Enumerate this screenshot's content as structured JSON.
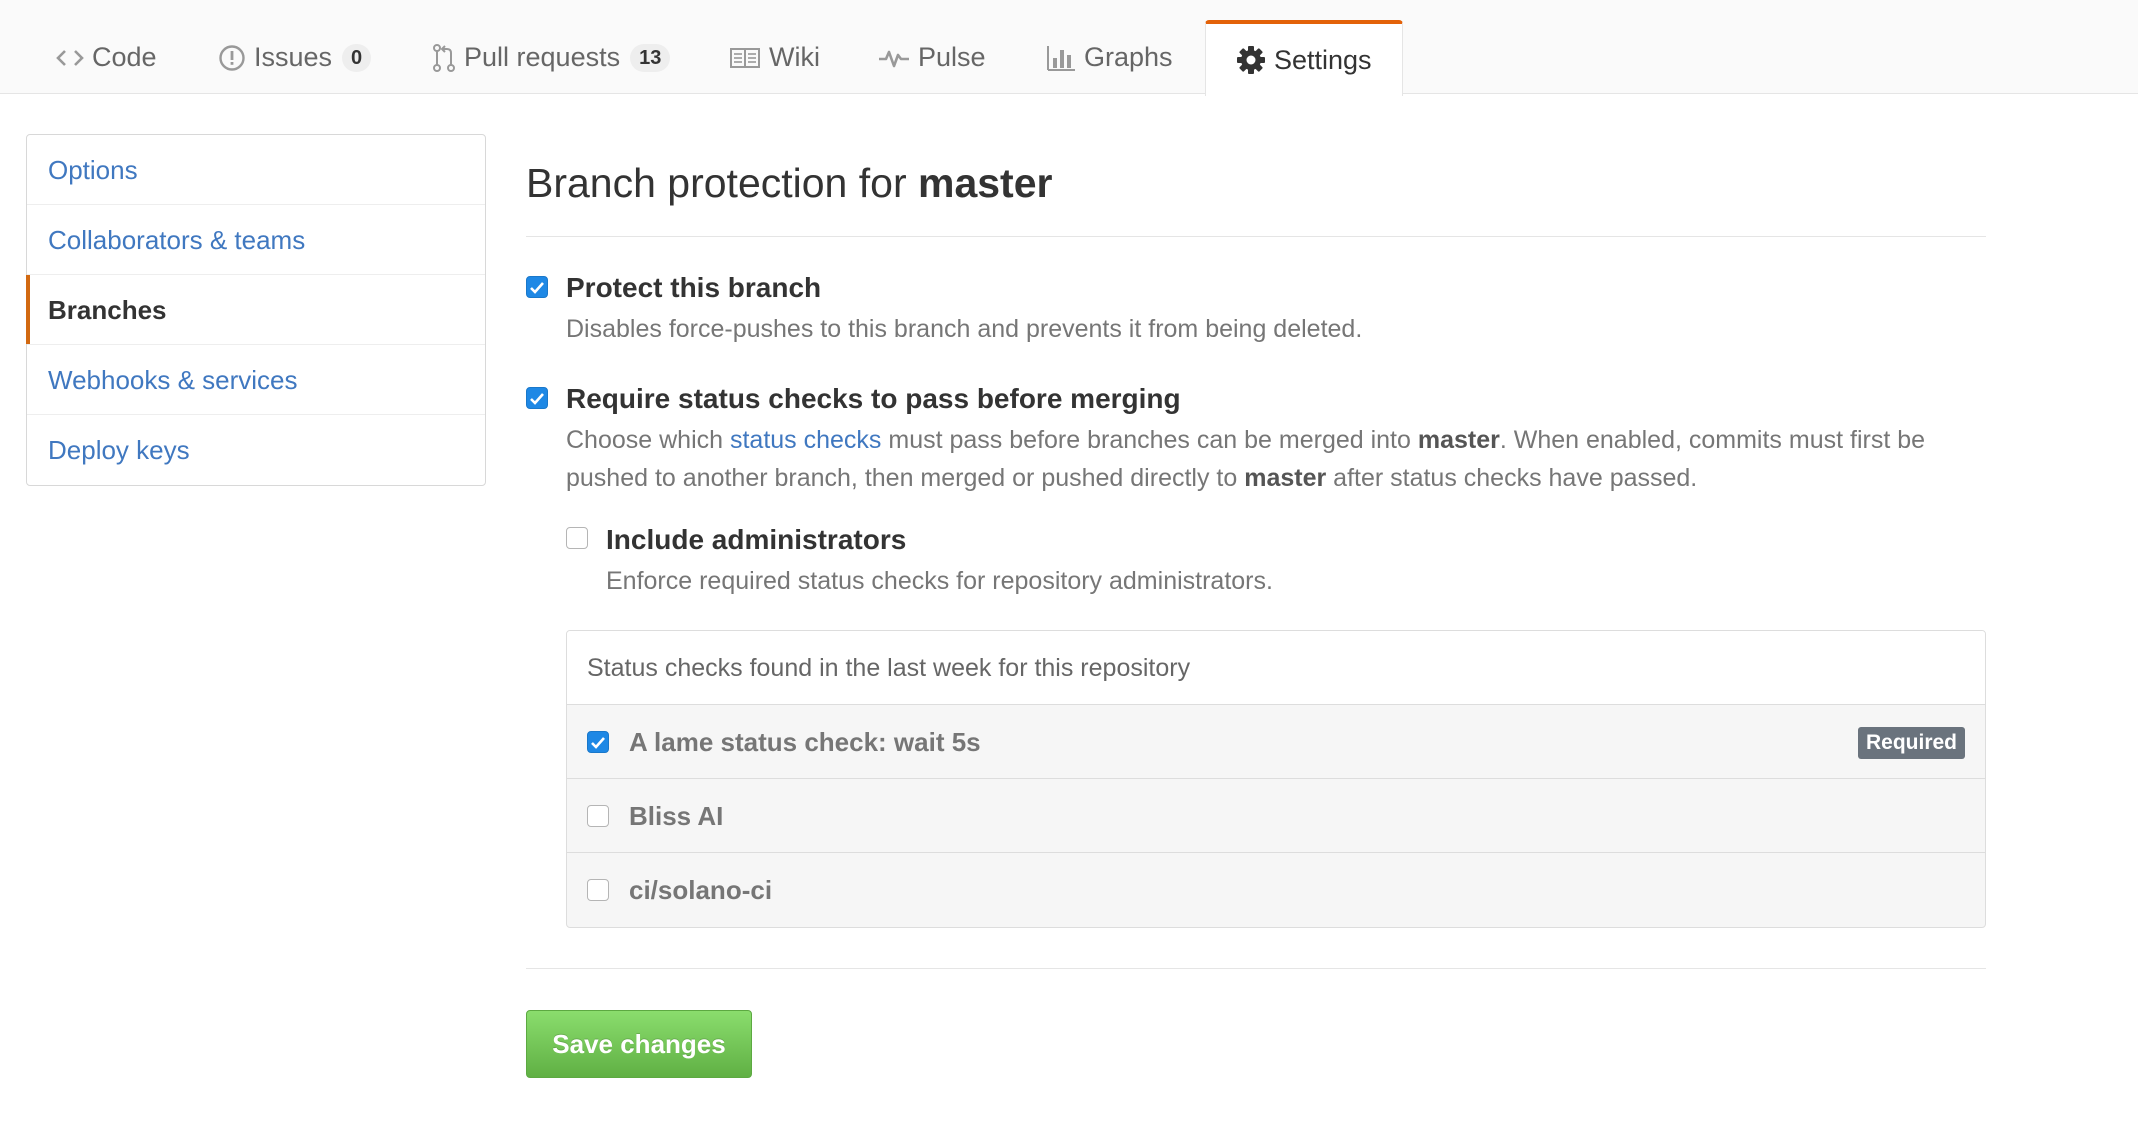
{
  "tabs": [
    {
      "label": "Code",
      "icon": "code-icon"
    },
    {
      "label": "Issues",
      "icon": "issue-opened-icon",
      "count": "0"
    },
    {
      "label": "Pull requests",
      "icon": "git-pull-request-icon",
      "count": "13"
    },
    {
      "label": "Wiki",
      "icon": "book-icon"
    },
    {
      "label": "Pulse",
      "icon": "pulse-icon"
    },
    {
      "label": "Graphs",
      "icon": "graph-icon"
    },
    {
      "label": "Settings",
      "icon": "gear-icon",
      "selected": true
    }
  ],
  "sidebar": {
    "items": [
      {
        "label": "Options"
      },
      {
        "label": "Collaborators & teams"
      },
      {
        "label": "Branches",
        "selected": true
      },
      {
        "label": "Webhooks & services"
      },
      {
        "label": "Deploy keys"
      }
    ]
  },
  "main": {
    "heading_prefix": "Branch protection for ",
    "heading_branch": "master",
    "protect": {
      "checked": true,
      "title": "Protect this branch",
      "note": "Disables force-pushes to this branch and prevents it from being deleted."
    },
    "status_checks": {
      "checked": true,
      "title": "Require status checks to pass before merging",
      "note_1": "Choose which ",
      "note_link": "status checks",
      "note_2": " must pass before branches can be merged into ",
      "note_branch_1": "master",
      "note_3": ". When enabled, commits must first be pushed to another branch, then merged or pushed directly to ",
      "note_branch_2": "master",
      "note_4": " after status checks have passed."
    },
    "admins": {
      "checked": false,
      "title": "Include administrators",
      "note": "Enforce required status checks for repository administrators."
    },
    "checks_box": {
      "header": "Status checks found in the last week for this repository",
      "rows": [
        {
          "name": "A lame status check: wait 5s",
          "checked": true,
          "badge": "Required"
        },
        {
          "name": "Bliss AI",
          "checked": false
        },
        {
          "name": "ci/solano-ci",
          "checked": false
        }
      ]
    },
    "save_label": "Save changes"
  },
  "colors": {
    "accent_tab": "#e36209",
    "link": "#4078c0",
    "checkbox": "#1e88e5",
    "save_green": "#60b044",
    "badge": "#6a737d"
  }
}
